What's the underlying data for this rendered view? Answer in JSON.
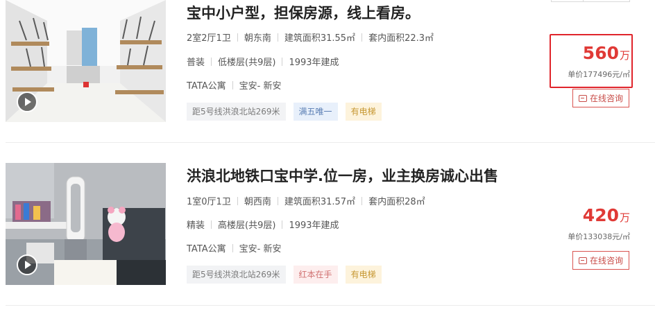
{
  "listings": [
    {
      "title": "宝中小户型，担保房源，线上看房。",
      "layout": "2室2厅1卫",
      "orientation": "朝东南",
      "build_area": "建筑面积31.55㎡",
      "inner_area": "套内面积22.3㎡",
      "decoration": "普装",
      "floor": "低楼层(共9层)",
      "year": "1993年建成",
      "community": "TATA公寓",
      "district": "宝安- 新安",
      "tags": [
        "距5号线洪浪北站269米",
        "满五唯一",
        "有电梯"
      ],
      "price": "560",
      "price_unit": "万",
      "unit_price": "单价177496元/㎡",
      "consult_label": "在线咨询"
    },
    {
      "title": "洪浪北地铁口宝中学.位一房，业主换房诚心出售",
      "layout": "1室0厅1卫",
      "orientation": "朝西南",
      "build_area": "建筑面积31.57㎡",
      "inner_area": "套内面积28㎡",
      "decoration": "精装",
      "floor": "高楼层(共9层)",
      "year": "1993年建成",
      "community": "TATA公寓",
      "district": "宝安- 新安",
      "tags": [
        "距5号线洪浪北站269米",
        "红本在手",
        "有电梯"
      ],
      "price": "420",
      "price_unit": "万",
      "unit_price": "单价133038元/㎡",
      "consult_label": "在线咨询"
    }
  ],
  "colors": {
    "price": "#e03a36",
    "highlight": "#e0242b",
    "accent": "#c84b47"
  }
}
